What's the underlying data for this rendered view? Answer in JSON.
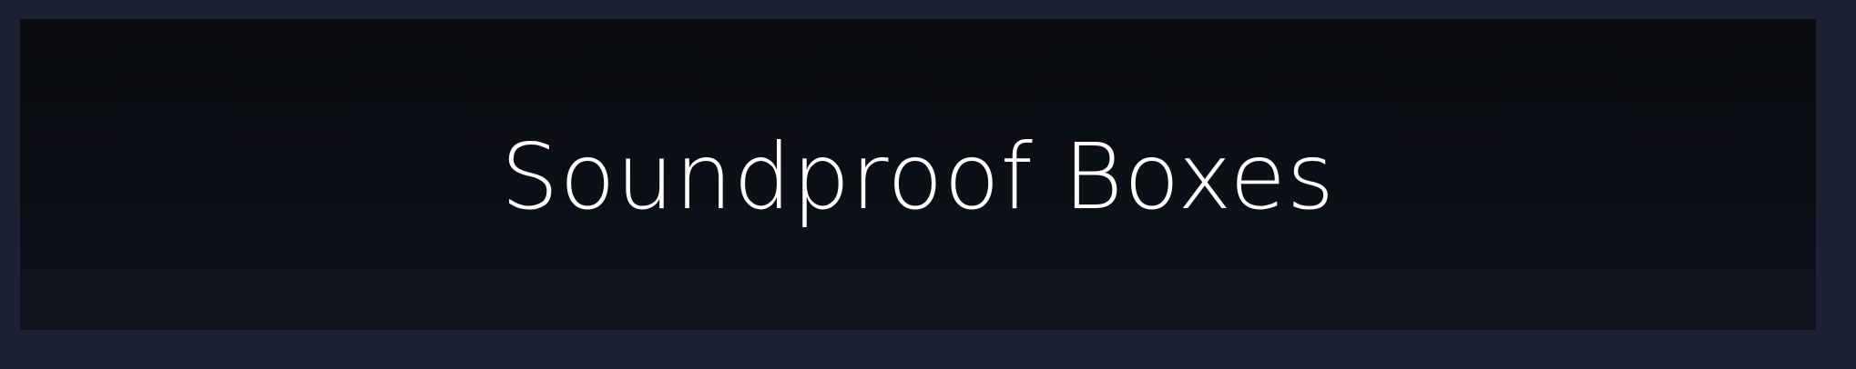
{
  "banner": {
    "title": "Soundproof Boxes"
  },
  "colors": {
    "outer_border": "#1c2133",
    "panel_background": "#0c0f16",
    "title_text": "#ffffff"
  }
}
